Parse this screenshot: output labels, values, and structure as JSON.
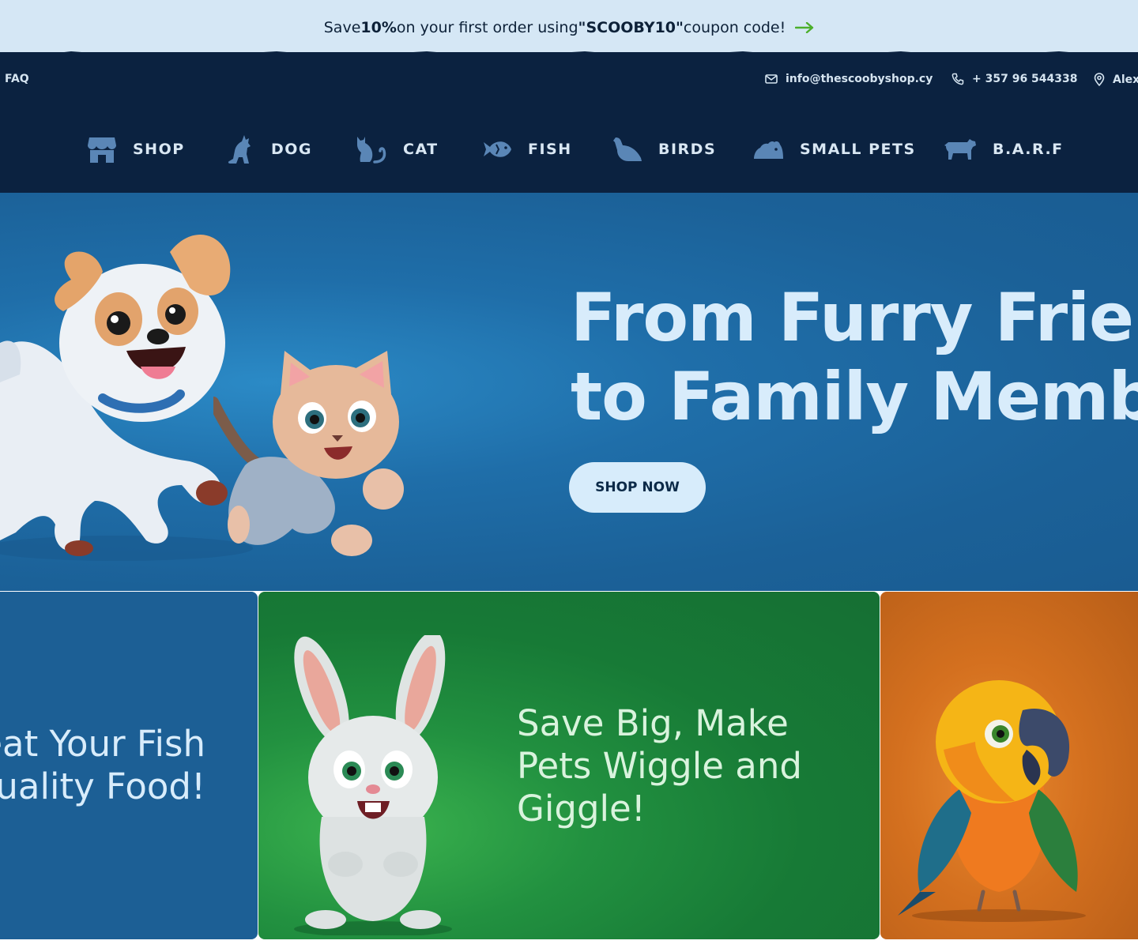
{
  "promo": {
    "prefix": "Save ",
    "percent": "10%",
    "middle": " on your first order using ",
    "code": "\"SCOOBY10\"",
    "suffix": " coupon code!"
  },
  "topbar": {
    "faq": "FAQ",
    "email": "info@thescoobyshop.cy",
    "phone": "+ 357 96 544338",
    "location": "Alex"
  },
  "nav": {
    "items": [
      {
        "label": "SHOP",
        "icon": "shop-icon"
      },
      {
        "label": "DOG",
        "icon": "dog-icon"
      },
      {
        "label": "CAT",
        "icon": "cat-icon"
      },
      {
        "label": "FISH",
        "icon": "fish-icon"
      },
      {
        "label": "BIRDS",
        "icon": "bird-icon"
      },
      {
        "label": "SMALL PETS",
        "icon": "mouse-icon"
      },
      {
        "label": "B.A.R.F",
        "icon": "cow-icon"
      }
    ]
  },
  "hero": {
    "title_line1": "From Furry Friends",
    "title_line2": "to Family Members",
    "cta": "SHOP NOW"
  },
  "cards": {
    "fish_line1": "Treat Your Fish",
    "fish_line2": "to Quality Food!",
    "sale_line1": "Save Big, Make",
    "sale_line2": "Pets Wiggle and",
    "sale_line3": "Giggle!"
  },
  "colors": {
    "promo_bg": "#d5e7f5",
    "navy": "#0b2240",
    "hero_blue": "#1f6ea9",
    "green": "#229140",
    "orange": "#d4701f",
    "arrow_green": "#4caf2b"
  }
}
